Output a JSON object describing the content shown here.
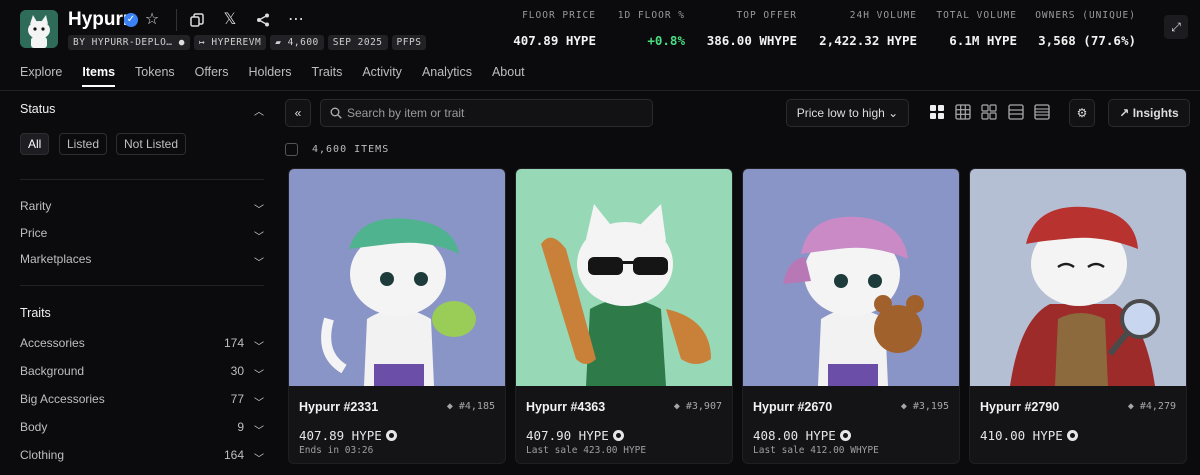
{
  "collection": {
    "title": "Hypurr",
    "chips": [
      "BY HYPURR-DEPLO…",
      "↦ HYPEREVM",
      "4,600",
      "SEP 2025",
      "PFPS"
    ]
  },
  "stats": [
    {
      "label": "FLOOR PRICE",
      "value": "407.89 HYPE"
    },
    {
      "label": "1D FLOOR %",
      "value": "+0.8%"
    },
    {
      "label": "TOP OFFER",
      "value": "386.00 WHYPE"
    },
    {
      "label": "24H VOLUME",
      "value": "2,422.32 HYPE"
    },
    {
      "label": "TOTAL VOLUME",
      "value": "6.1M HYPE"
    },
    {
      "label": "OWNERS (UNIQUE)",
      "value": "3,568 (77.6%)"
    }
  ],
  "tabs": [
    "Explore",
    "Items",
    "Tokens",
    "Offers",
    "Holders",
    "Traits",
    "Activity",
    "Analytics",
    "About"
  ],
  "sidebar": {
    "status_title": "Status",
    "status_filters": [
      "All",
      "Listed",
      "Not Listed"
    ],
    "filters": [
      "Rarity",
      "Price",
      "Marketplaces"
    ],
    "traits_title": "Traits",
    "traits": [
      {
        "label": "Accessories",
        "count": "174"
      },
      {
        "label": "Background",
        "count": "30"
      },
      {
        "label": "Big Accessories",
        "count": "77"
      },
      {
        "label": "Body",
        "count": "9"
      },
      {
        "label": "Clothing",
        "count": "164"
      }
    ]
  },
  "toolbar": {
    "search_placeholder": "Search by item or trait",
    "sort_label": "Price low to high",
    "insights_label": "Insights",
    "item_count": "4,600 ITEMS"
  },
  "items": [
    {
      "name": "Hypurr #2331",
      "rank": "#4,185",
      "price": "407.89 HYPE",
      "sub": "Ends in 03:26",
      "bg": "#8a95c7",
      "hat": "#4fb38f"
    },
    {
      "name": "Hypurr #4363",
      "rank": "#3,907",
      "price": "407.90 HYPE",
      "sub": "Last sale 423.00 HYPE",
      "bg": "#97d9b6",
      "hat": "none"
    },
    {
      "name": "Hypurr #2670",
      "rank": "#3,195",
      "price": "408.00 HYPE",
      "sub": "Last sale 412.00 WHYPE",
      "bg": "#8a95c7",
      "hat": "#c98ac6"
    },
    {
      "name": "Hypurr #2790",
      "rank": "#4,279",
      "price": "410.00 HYPE",
      "sub": "",
      "bg": "#b5bfd4",
      "hat": "#b8322f"
    }
  ]
}
